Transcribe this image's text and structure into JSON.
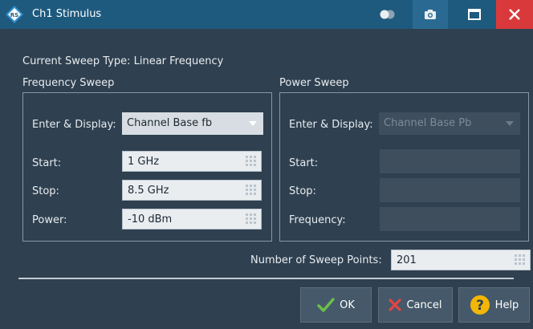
{
  "window": {
    "title": "Ch1 Stimulus"
  },
  "icons": {
    "logo": "rohde-schwarz-logo-icon",
    "toggle": "toggle-icon",
    "camera": "camera-icon",
    "maximize": "maximize-icon",
    "close": "close-icon",
    "keypad": "keypad-icon",
    "ok": "checkmark-icon",
    "cancel": "x-icon",
    "help": "question-icon"
  },
  "sweep_type": {
    "label": "Current Sweep Type:",
    "value": "Linear Frequency"
  },
  "frequency_sweep": {
    "title": "Frequency Sweep",
    "enter_display_label": "Enter & Display:",
    "enter_display_value": "Channel Base fb",
    "start_label": "Start:",
    "start_value": "1 GHz",
    "stop_label": "Stop:",
    "stop_value": "8.5 GHz",
    "power_label": "Power:",
    "power_value": "-10 dBm"
  },
  "power_sweep": {
    "title": "Power Sweep",
    "enter_display_label": "Enter & Display:",
    "enter_display_value": "Channel Base Pb",
    "start_label": "Start:",
    "stop_label": "Stop:",
    "frequency_label": "Frequency:"
  },
  "sweep_points": {
    "label": "Number of Sweep Points:",
    "value": "201"
  },
  "buttons": {
    "ok": "OK",
    "cancel": "Cancel",
    "help": "Help"
  },
  "colors": {
    "titlebar": "#1e5a7e",
    "background": "#2f4050",
    "close": "#d9393b",
    "ok_check": "#6cc04a",
    "cancel_x": "#e04545",
    "help": "#f2b705"
  }
}
